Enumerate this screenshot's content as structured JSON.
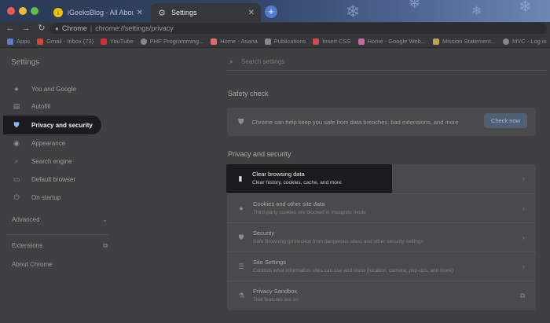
{
  "tabs": [
    {
      "label": "iGeeksBlog - All About iPhone, iPad...",
      "active": false,
      "favicon": "igeeksblog-favicon"
    },
    {
      "label": "Settings",
      "active": true,
      "favicon": "gear-icon"
    }
  ],
  "toolbar": {
    "omnibox_site": "Chrome",
    "omnibox_sep": "|",
    "omnibox_url": "chrome://settings/privacy"
  },
  "bookmarks": [
    {
      "label": "Apps",
      "color": "#5a7bd0"
    },
    {
      "label": "Gmail - Inbox (73)",
      "color": "#d0463a"
    },
    {
      "label": "YouTube",
      "color": "#d03030"
    },
    {
      "label": "PHP Programming...",
      "color": "#888888"
    },
    {
      "label": "Home - Asana",
      "color": "#e06a6a"
    },
    {
      "label": "Publications",
      "color": "#888888"
    },
    {
      "label": "Insert CSS",
      "color": "#d04a4a"
    },
    {
      "label": "Home - Google Web...",
      "color": "#c76aa0"
    },
    {
      "label": "Mission Statement...",
      "color": "#c2a24a"
    },
    {
      "label": "MVC - Log in",
      "color": "#888888"
    }
  ],
  "sidebar": {
    "title": "Settings",
    "items": [
      {
        "label": "You and Google",
        "icon": "person-icon"
      },
      {
        "label": "Autofill",
        "icon": "autofill-icon"
      },
      {
        "label": "Privacy and security",
        "icon": "shield-icon"
      },
      {
        "label": "Appearance",
        "icon": "palette-icon"
      },
      {
        "label": "Search engine",
        "icon": "search-icon"
      },
      {
        "label": "Default browser",
        "icon": "browser-icon"
      },
      {
        "label": "On startup",
        "icon": "power-icon"
      }
    ],
    "advanced": "Advanced",
    "extensions": "Extensions",
    "about": "About Chrome"
  },
  "search": {
    "placeholder": "Search settings"
  },
  "safety_check": {
    "title": "Safety check",
    "text": "Chrome can help keep you safe from data breaches, bad extensions, and more",
    "button": "Check now"
  },
  "privacy": {
    "title": "Privacy and security",
    "rows": [
      {
        "title": "Clear browsing data",
        "subtitle": "Clear history, cookies, cache, and more",
        "icon": "trash-icon"
      },
      {
        "title": "Cookies and other site data",
        "subtitle": "Third-party cookies are blocked in Incognito mode",
        "icon": "cookie-icon"
      },
      {
        "title": "Security",
        "subtitle": "Safe Browsing (protection from dangerous sites) and other security settings",
        "icon": "shield-icon"
      },
      {
        "title": "Site Settings",
        "subtitle": "Controls what information sites can use and show (location, camera, pop-ups, and more)",
        "icon": "sliders-icon"
      },
      {
        "title": "Privacy Sandbox",
        "subtitle": "Trial features are on",
        "icon": "flask-icon"
      }
    ]
  }
}
